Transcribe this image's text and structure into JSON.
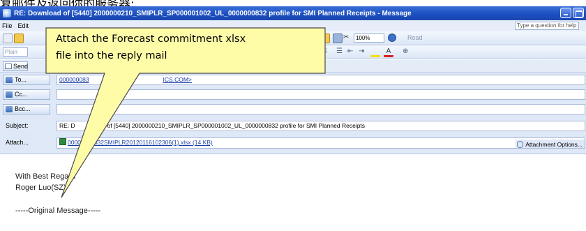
{
  "top_caption": "复邮件及返回你的服务器:",
  "window": {
    "title": "RE: Download of [5440] 2000000210_SMIPLR_SP000001002_UL_0000000832 profile for SMI Planned Receipts - Message",
    "menu": [
      "File",
      "Edit"
    ],
    "help_box": "Type a question for help",
    "toolbar": {
      "zoom": "100%",
      "read_label": "Read"
    },
    "send_label": "Send"
  },
  "header": {
    "to_label": "To...",
    "to_value_left": "000000083",
    "to_value_right": "ICS.COM>",
    "cc_label": "Cc...",
    "bcc_label": "Bcc...",
    "subject_label": "Subject:",
    "subject_prefix": "RE: D",
    "subject_value": "ad of [5440] 2000000210_SMIPLR_SP000001002_UL_0000000832 profile for SMI Planned Receipts",
    "attach_label": "Attach...",
    "attachment_name": "00000000832SMIPLR20120116102306(1).xlsx (14 KB)",
    "attachment_options": "Attachment Options..."
  },
  "body": {
    "greeting": "With Best Regard",
    "signature": "Roger Luo(SZ)",
    "original": "-----Original Message-----"
  },
  "callout": {
    "line1": "Attach the Forecast commitment xlsx",
    "line2": "file into the reply mail",
    "fill_color": "#fffca8",
    "stroke_color": "#4a4a4a"
  }
}
